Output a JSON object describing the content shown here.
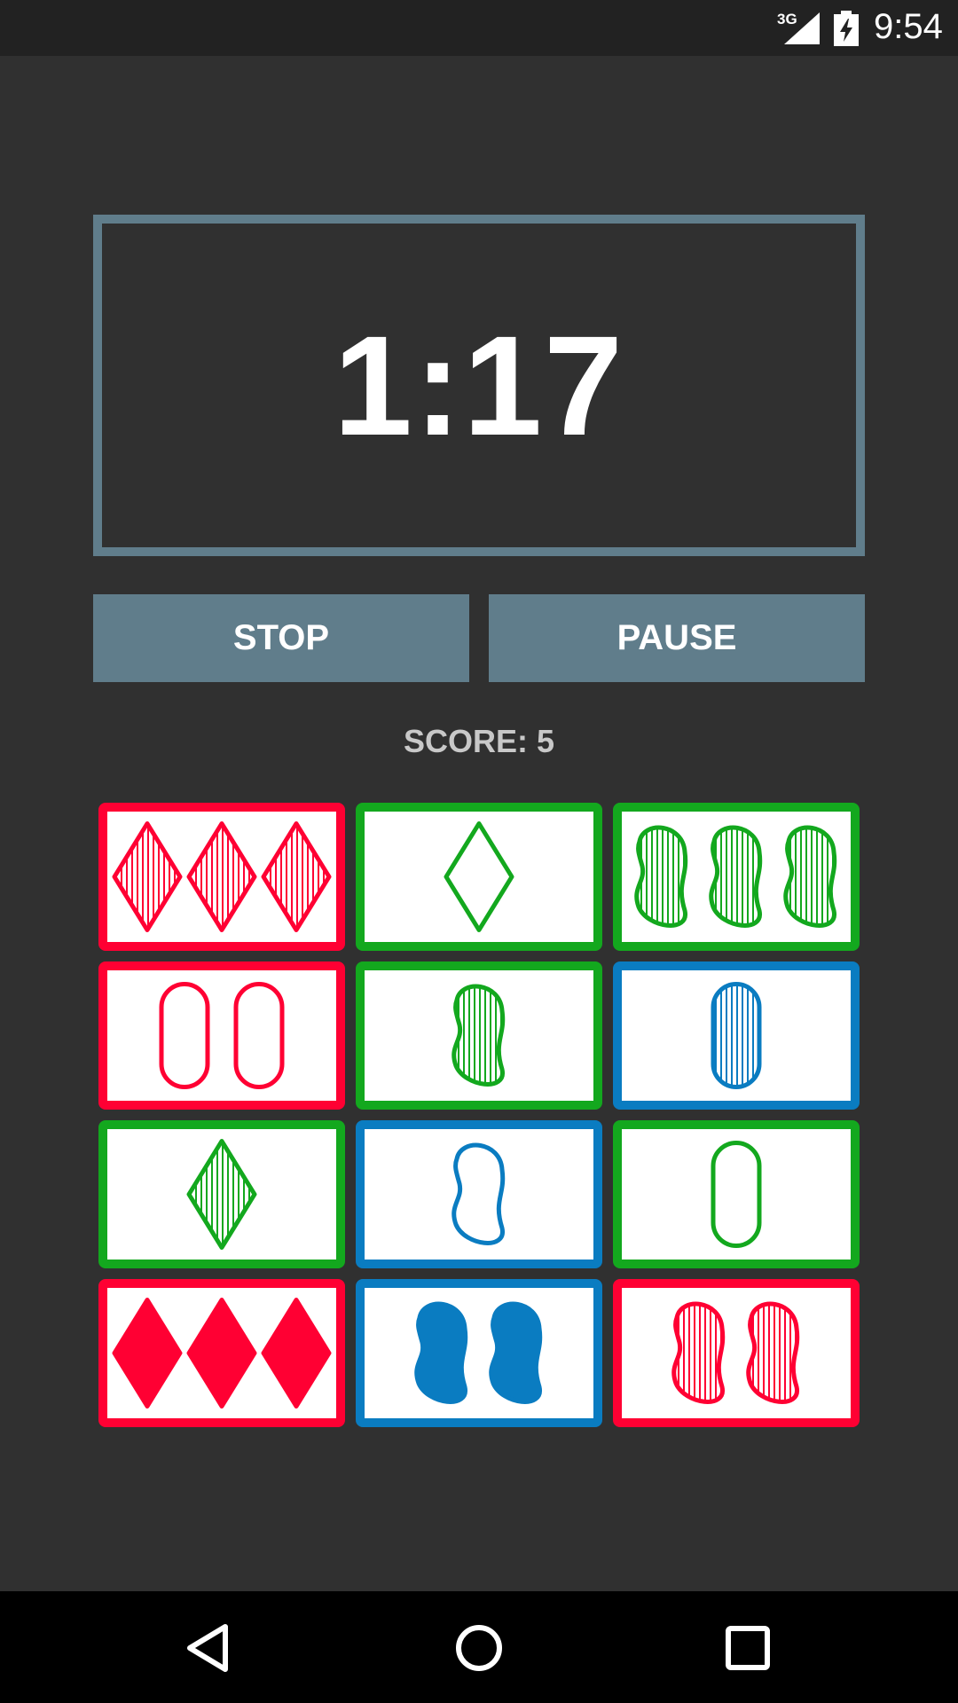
{
  "status_bar": {
    "network": "3G",
    "time": "9:54",
    "icons": [
      "signal-icon",
      "battery-charging-icon"
    ]
  },
  "timer": {
    "value": "1:17"
  },
  "buttons": {
    "stop_label": "STOP",
    "pause_label": "PAUSE"
  },
  "score": {
    "text": "SCORE: 5"
  },
  "colors": {
    "red": "#ff0033",
    "green": "#13a81e",
    "blue": "#0a7cc1",
    "slate": "#607d8b",
    "background": "#303030"
  },
  "cards": [
    {
      "count": 3,
      "shape": "diamond",
      "fill": "striped",
      "color": "red"
    },
    {
      "count": 1,
      "shape": "diamond",
      "fill": "empty",
      "color": "green"
    },
    {
      "count": 3,
      "shape": "squiggle",
      "fill": "striped",
      "color": "green"
    },
    {
      "count": 2,
      "shape": "oval",
      "fill": "empty",
      "color": "red"
    },
    {
      "count": 1,
      "shape": "squiggle",
      "fill": "striped",
      "color": "green"
    },
    {
      "count": 1,
      "shape": "oval",
      "fill": "striped",
      "color": "blue"
    },
    {
      "count": 1,
      "shape": "diamond",
      "fill": "striped",
      "color": "green"
    },
    {
      "count": 1,
      "shape": "squiggle",
      "fill": "empty",
      "color": "blue"
    },
    {
      "count": 1,
      "shape": "oval",
      "fill": "empty",
      "color": "green"
    },
    {
      "count": 3,
      "shape": "diamond",
      "fill": "solid",
      "color": "red"
    },
    {
      "count": 2,
      "shape": "squiggle",
      "fill": "solid",
      "color": "blue"
    },
    {
      "count": 2,
      "shape": "squiggle",
      "fill": "striped",
      "color": "red"
    }
  ],
  "nav_bar": {
    "icons": [
      "back-icon",
      "home-icon",
      "recents-icon"
    ]
  }
}
